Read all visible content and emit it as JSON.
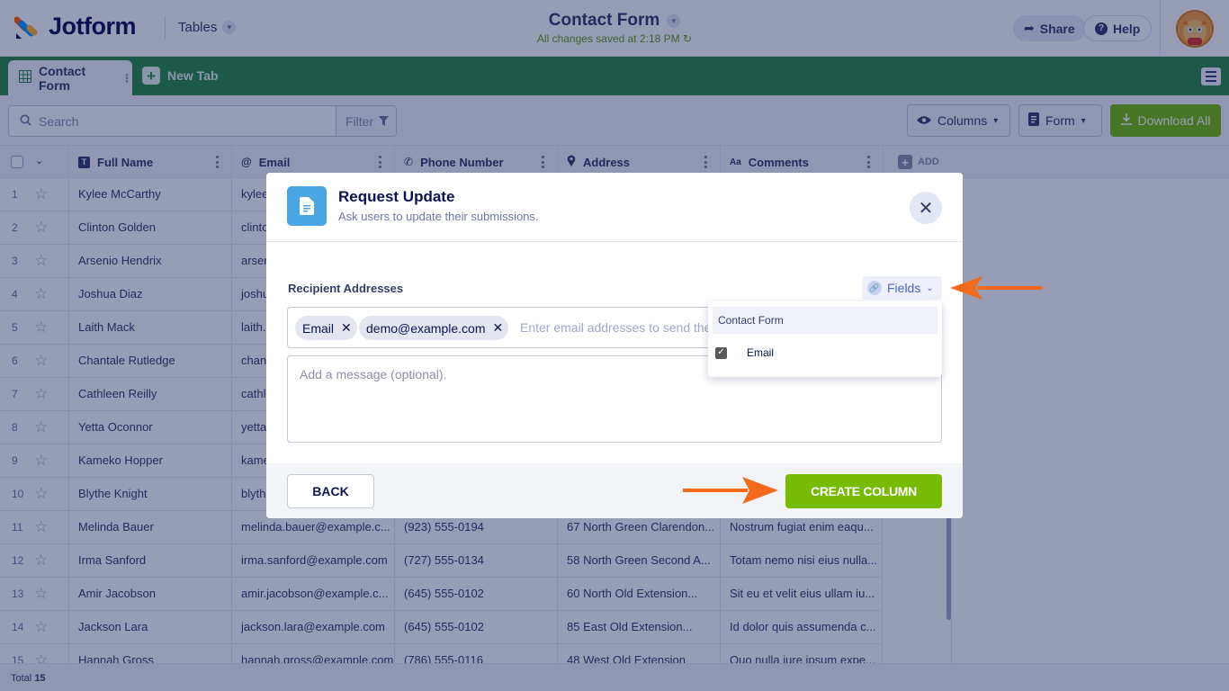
{
  "header": {
    "logo_text": "Jotform",
    "tables_label": "Tables",
    "title": "Contact Form",
    "saved_status": "All changes saved at 2:18 PM",
    "share_label": "Share",
    "help_label": "Help"
  },
  "tabs": {
    "active_label": "Contact Form",
    "new_tab_label": "New Tab"
  },
  "toolbar": {
    "search_placeholder": "Search",
    "filter_label": "Filter",
    "columns_label": "Columns",
    "form_label": "Form",
    "download_label": "Download All"
  },
  "table": {
    "headers": [
      "Full Name",
      "Email",
      "Phone Number",
      "Address",
      "Comments"
    ],
    "add_label": "ADD",
    "rows": [
      {
        "n": "1",
        "name": "Kylee McCarthy",
        "email": "kylee",
        "phone": "",
        "address": "",
        "comment": ""
      },
      {
        "n": "2",
        "name": "Clinton Golden",
        "email": "clinto",
        "phone": "",
        "address": "",
        "comment": ""
      },
      {
        "n": "3",
        "name": "Arsenio Hendrix",
        "email": "arsen",
        "phone": "",
        "address": "",
        "comment": ""
      },
      {
        "n": "4",
        "name": "Joshua Diaz",
        "email": "joshu",
        "phone": "",
        "address": "",
        "comment": ""
      },
      {
        "n": "5",
        "name": "Laith Mack",
        "email": "laith.",
        "phone": "",
        "address": "",
        "comment": ""
      },
      {
        "n": "6",
        "name": "Chantale Rutledge",
        "email": "chant",
        "phone": "",
        "address": "",
        "comment": ""
      },
      {
        "n": "7",
        "name": "Cathleen Reilly",
        "email": "cathl",
        "phone": "",
        "address": "",
        "comment": ""
      },
      {
        "n": "8",
        "name": "Yetta Oconnor",
        "email": "yetta",
        "phone": "",
        "address": "",
        "comment": ""
      },
      {
        "n": "9",
        "name": "Kameko Hopper",
        "email": "kame",
        "phone": "",
        "address": "",
        "comment": ""
      },
      {
        "n": "10",
        "name": "Blythe Knight",
        "email": "blyth",
        "phone": "",
        "address": "",
        "comment": ""
      },
      {
        "n": "11",
        "name": "Melinda Bauer",
        "email": "melinda.bauer@example.c...",
        "phone": "(923) 555-0194",
        "address": "67 North Green Clarendon...",
        "comment": "Nostrum fugiat enim eaqu..."
      },
      {
        "n": "12",
        "name": "Irma Sanford",
        "email": "irma.sanford@example.com",
        "phone": "(727) 555-0134",
        "address": "58 North Green Second A...",
        "comment": "Totam nemo nisi eius nulla..."
      },
      {
        "n": "13",
        "name": "Amir Jacobson",
        "email": "amir.jacobson@example.c...",
        "phone": "(645) 555-0102",
        "address": "60 North Old Extension...",
        "comment": "Sit eu et velit eius ullam iu..."
      },
      {
        "n": "14",
        "name": "Jackson Lara",
        "email": "jackson.lara@example.com",
        "phone": "(645) 555-0102",
        "address": "85 East Old Extension...",
        "comment": "Id dolor quis assumenda c..."
      },
      {
        "n": "15",
        "name": "Hannah Gross",
        "email": "hannah.gross@example.com",
        "phone": "(786) 555-0116",
        "address": "48 West Old Extension",
        "comment": "Quo nulla iure ipsum expe..."
      }
    ]
  },
  "footer": {
    "total_label": "Total",
    "total_count": "15"
  },
  "modal": {
    "title": "Request Update",
    "subtitle": "Ask users to update their submissions.",
    "recipients_label": "Recipient Addresses",
    "fields_label": "Fields",
    "chips": [
      "Email",
      "demo@example.com"
    ],
    "recipients_placeholder": "Enter email addresses to send the",
    "message_placeholder": "Add a message (optional).",
    "back_label": "BACK",
    "create_label": "CREATE COLUMN"
  },
  "dropdown": {
    "group_label": "Contact Form",
    "item_label": "Email",
    "item_checked": true
  },
  "colors": {
    "brand_green": "#2c8b43",
    "action_green": "#78bb07",
    "arrow_orange": "#f26b1d",
    "icon_blue": "#4aa5e3"
  }
}
